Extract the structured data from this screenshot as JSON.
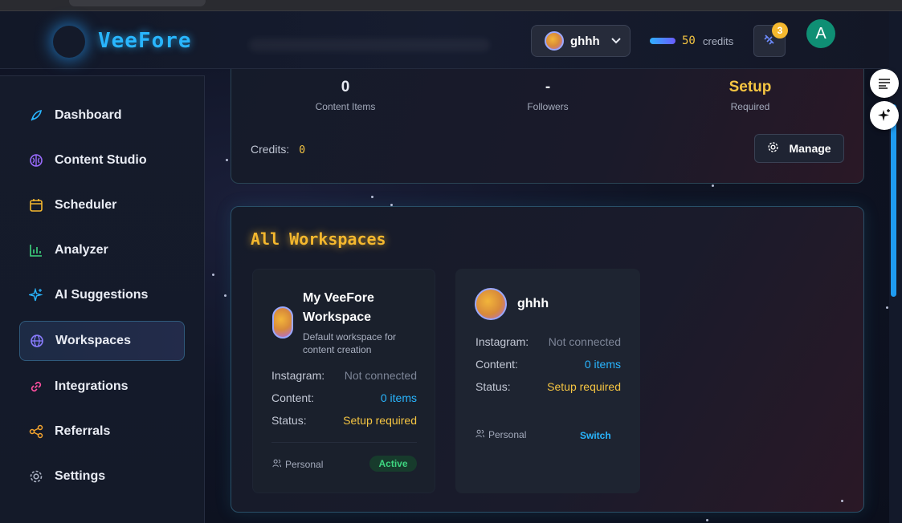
{
  "app": {
    "logo": "VeeFore"
  },
  "header": {
    "workspace_name": "ghhh",
    "credits_value": "50",
    "credits_label": "credits",
    "notification_count": "3",
    "user_initial": "A"
  },
  "sidebar": {
    "items": [
      {
        "label": "Dashboard",
        "icon": "rocket-icon",
        "color": "#29b6ff"
      },
      {
        "label": "Content Studio",
        "icon": "brain-icon",
        "color": "#9b6cff"
      },
      {
        "label": "Scheduler",
        "icon": "calendar-icon",
        "color": "#f5b82e"
      },
      {
        "label": "Analyzer",
        "icon": "bar-chart-icon",
        "color": "#3ed680"
      },
      {
        "label": "AI Suggestions",
        "icon": "sparkles-icon",
        "color": "#29b6ff"
      },
      {
        "label": "Workspaces",
        "icon": "globe-icon",
        "color": "#8a7cff",
        "active": true
      },
      {
        "label": "Integrations",
        "icon": "link-icon",
        "color": "#ff4fa0"
      },
      {
        "label": "Referrals",
        "icon": "share-icon",
        "color": "#f5a42e"
      },
      {
        "label": "Settings",
        "icon": "gear-icon",
        "color": "#aab1c2"
      }
    ]
  },
  "summary": {
    "stats": [
      {
        "value": "0",
        "label": "Content Items"
      },
      {
        "value": "-",
        "label": "Followers"
      },
      {
        "value": "Setup",
        "label": "Required"
      }
    ],
    "credits_label": "Credits:",
    "credits_value": "0",
    "manage_label": "Manage"
  },
  "workspaces": {
    "title": "All Workspaces",
    "cards": [
      {
        "name_line1": "My VeeFore",
        "name_line2": "Workspace",
        "desc_line1": "Default workspace for",
        "desc_line2": "content creation",
        "instagram_label": "Instagram:",
        "instagram_value": "Not connected",
        "content_label": "Content:",
        "content_value": "0 items",
        "status_label": "Status:",
        "status_value": "Setup required",
        "type": "Personal",
        "badge": "Active"
      },
      {
        "name": "ghhh",
        "instagram_label": "Instagram:",
        "instagram_value": "Not connected",
        "content_label": "Content:",
        "content_value": "0 items",
        "status_label": "Status:",
        "status_value": "Setup required",
        "type": "Personal",
        "action": "Switch"
      }
    ]
  }
}
